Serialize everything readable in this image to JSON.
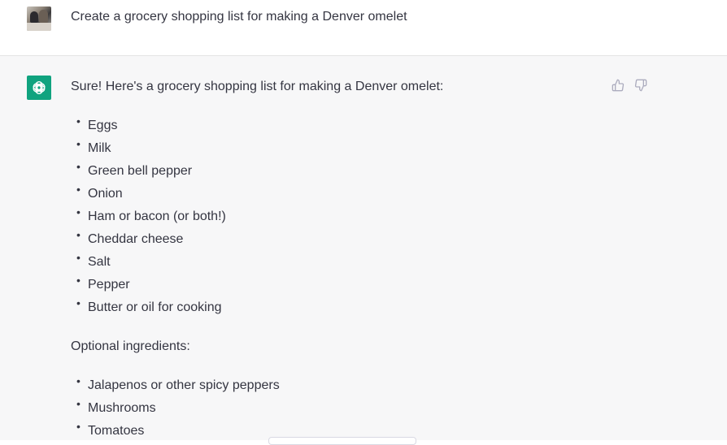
{
  "user_message": {
    "text": "Create a grocery shopping list for making a Denver omelet",
    "avatar_icon": "user-avatar-photo"
  },
  "assistant_message": {
    "avatar_icon": "openai-logo-icon",
    "avatar_color": "#10a37f",
    "intro": "Sure! Here's a grocery shopping list for making a Denver omelet:",
    "items": [
      "Eggs",
      "Milk",
      "Green bell pepper",
      "Onion",
      "Ham or bacon (or both!)",
      "Cheddar cheese",
      "Salt",
      "Pepper",
      "Butter or oil for cooking"
    ],
    "optional_heading": "Optional ingredients:",
    "optional_items": [
      "Jalapenos or other spicy peppers",
      "Mushrooms",
      "Tomatoes"
    ],
    "bullet": "•"
  },
  "feedback": {
    "thumbs_up_icon": "thumbs-up-icon",
    "thumbs_down_icon": "thumbs-down-icon"
  }
}
